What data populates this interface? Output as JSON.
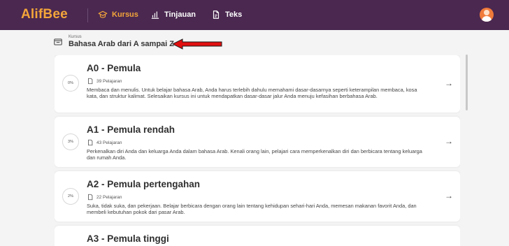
{
  "app": {
    "logo": "AlifBee"
  },
  "nav": {
    "items": [
      {
        "label": "Kursus",
        "icon": "graduation-cap-icon",
        "active": true
      },
      {
        "label": "Tinjauan",
        "icon": "bar-chart-icon",
        "active": false
      },
      {
        "label": "Teks",
        "icon": "document-edit-icon",
        "active": false
      }
    ]
  },
  "breadcrumb": {
    "small": "Kursus",
    "title": "Bahasa Arab dari A sampai Z"
  },
  "courses": [
    {
      "progress": "0%",
      "title": "A0 - Pemula",
      "lessons": "39 Pelajaran",
      "description": "Membaca dan menulis. Untuk belajar bahasa Arab, Anda harus terlebih dahulu memahami dasar-dasarnya seperti keterampilan membaca, kosa kata, dan struktur kalimat. Selesaikan kursus ini untuk mendapatkan dasar-dasar jalur Anda menuju kefasihan berbahasa Arab."
    },
    {
      "progress": "3%",
      "title": "A1 - Pemula rendah",
      "lessons": "43 Pelajaran",
      "description": "Perkenalkan diri Anda dan keluarga Anda dalam bahasa Arab. Kenali orang lain, pelajari cara memperkenalkan diri dan berbicara tentang keluarga dan rumah Anda."
    },
    {
      "progress": "2%",
      "title": "A2 - Pemula pertengahan",
      "lessons": "22 Pelajaran",
      "description": "Suka, tidak suka, dan pekerjaan. Belajar berbicara dengan orang lain tentang kehidupan sehari-hari Anda, memesan makanan favorit Anda, dan membeli kebutuhan pokok dari pasar Arab."
    },
    {
      "progress": "",
      "title": "A3 - Pemula tinggi",
      "lessons": "",
      "description": ""
    }
  ],
  "colors": {
    "topbar": "#4a2850",
    "accent": "#f3a53a",
    "annotation": "#e0100f"
  }
}
